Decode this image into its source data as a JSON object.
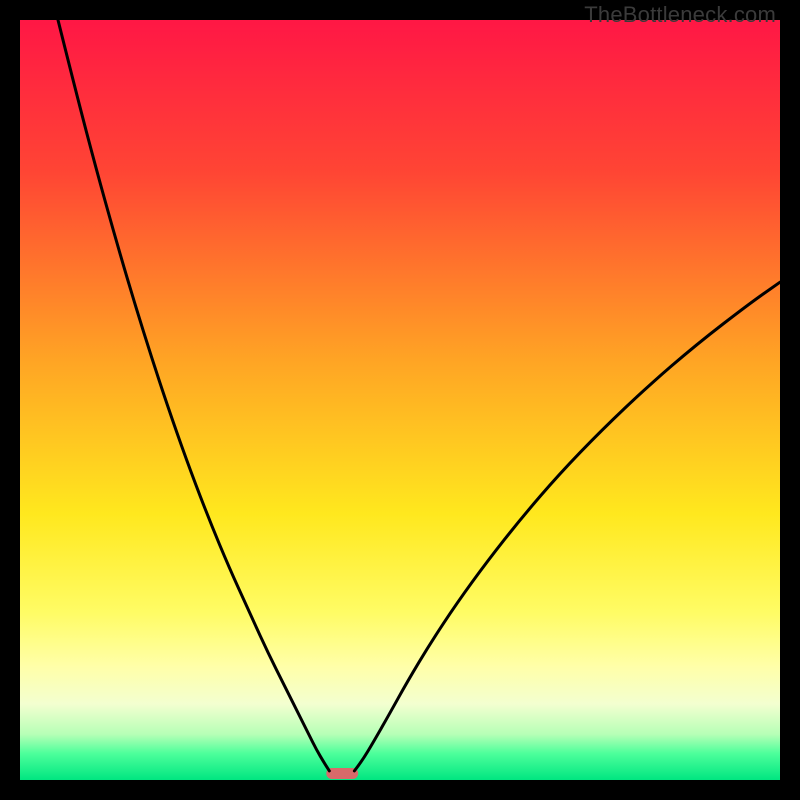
{
  "watermark": "TheBottleneck.com",
  "chart_data": {
    "type": "line",
    "title": "",
    "xlabel": "",
    "ylabel": "",
    "xlim": [
      0,
      100
    ],
    "ylim": [
      0,
      100
    ],
    "background_gradient": {
      "stops": [
        {
          "pos": 0.0,
          "color": "#ff1745"
        },
        {
          "pos": 0.2,
          "color": "#ff4534"
        },
        {
          "pos": 0.45,
          "color": "#ffa524"
        },
        {
          "pos": 0.65,
          "color": "#ffe81e"
        },
        {
          "pos": 0.78,
          "color": "#fffc65"
        },
        {
          "pos": 0.85,
          "color": "#ffffa8"
        },
        {
          "pos": 0.9,
          "color": "#f3ffd0"
        },
        {
          "pos": 0.94,
          "color": "#b6ffb6"
        },
        {
          "pos": 0.965,
          "color": "#4dff9b"
        },
        {
          "pos": 1.0,
          "color": "#00e681"
        }
      ]
    },
    "series": [
      {
        "name": "left-curve",
        "x": [
          5.0,
          7.5,
          10.0,
          12.5,
          15.0,
          17.5,
          20.0,
          22.5,
          25.0,
          27.5,
          30.0,
          32.5,
          35.0,
          36.5,
          38.0,
          39.0,
          40.0,
          40.7
        ],
        "y": [
          100.0,
          90.0,
          80.5,
          71.5,
          63.0,
          55.0,
          47.5,
          40.5,
          34.0,
          28.0,
          22.5,
          17.0,
          12.0,
          9.0,
          6.0,
          4.0,
          2.3,
          1.2
        ]
      },
      {
        "name": "right-curve",
        "x": [
          44.0,
          45.0,
          46.5,
          48.5,
          51.0,
          54.0,
          57.5,
          61.5,
          66.0,
          71.0,
          76.5,
          82.5,
          89.0,
          96.0,
          100.0
        ],
        "y": [
          1.2,
          2.5,
          5.0,
          8.5,
          13.0,
          18.0,
          23.3,
          28.8,
          34.5,
          40.3,
          46.0,
          51.7,
          57.3,
          62.7,
          65.5
        ]
      }
    ],
    "marker": {
      "name": "bottleneck-marker",
      "x_start": 40.3,
      "x_end": 44.5,
      "color": "#d86a6a"
    }
  }
}
